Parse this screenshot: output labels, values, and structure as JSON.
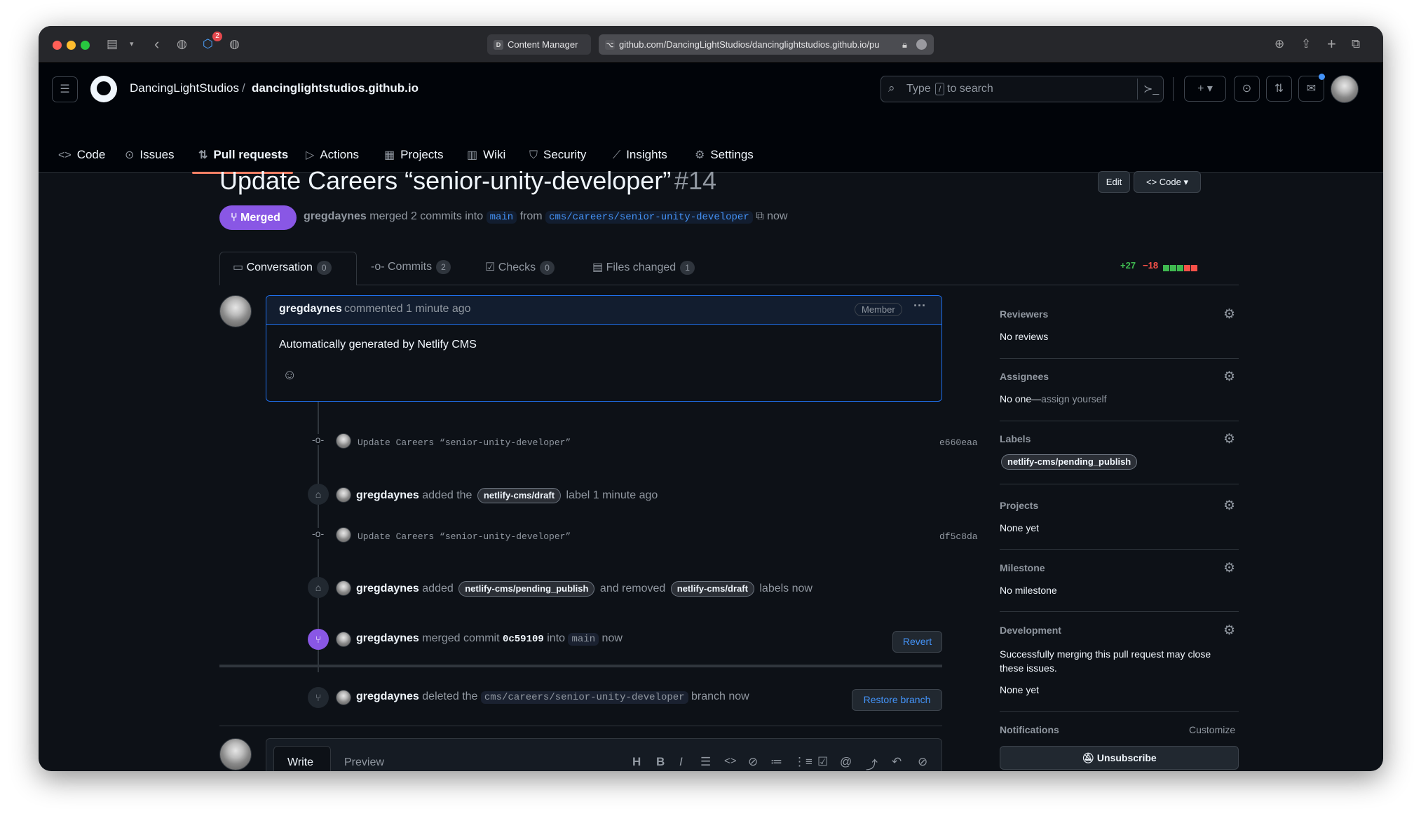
{
  "browser": {
    "tabs": [
      {
        "favicon": "D",
        "title": "Content Manager"
      },
      {
        "favicon": "⌥",
        "title": "github.com/DancingLightStudios/dancinglightstudios.github.io/pu"
      }
    ],
    "extension_badge": "2"
  },
  "header": {
    "owner": "DancingLightStudios",
    "separator": "/",
    "repo": "dancinglightstudios.github.io",
    "search_placeholder_pre": "Type",
    "search_key": "/",
    "search_placeholder_post": "to search",
    "nav": [
      {
        "label": "Code",
        "icon": "code-icon"
      },
      {
        "label": "Issues",
        "icon": "issue-icon"
      },
      {
        "label": "Pull requests",
        "icon": "pull-request-icon"
      },
      {
        "label": "Actions",
        "icon": "play-icon"
      },
      {
        "label": "Projects",
        "icon": "table-icon"
      },
      {
        "label": "Wiki",
        "icon": "book-icon"
      },
      {
        "label": "Security",
        "icon": "shield-icon"
      },
      {
        "label": "Insights",
        "icon": "graph-icon"
      },
      {
        "label": "Settings",
        "icon": "gear-icon"
      }
    ],
    "selected_nav": "Pull requests"
  },
  "pr": {
    "title": "Update Careers “senior-unity-developer”",
    "number": "#14",
    "edit_label": "Edit",
    "code_label": "Code",
    "state": "Merged",
    "author": "gregdaynes",
    "merge_text": "merged 2 commits into",
    "base": "main",
    "from_text": "from",
    "head": "cms/careers/senior-unity-developer",
    "time": "now",
    "tabs": [
      {
        "label": "Conversation",
        "count": "0"
      },
      {
        "label": "Commits",
        "count": "2"
      },
      {
        "label": "Checks",
        "count": "0"
      },
      {
        "label": "Files changed",
        "count": "1"
      }
    ],
    "additions": "+27",
    "deletions": "−18",
    "diffstat_colors": [
      "#3fb950",
      "#3fb950",
      "#3fb950",
      "#f85149",
      "#f85149"
    ]
  },
  "comment": {
    "author": "gregdaynes",
    "meta": "commented 1 minute ago",
    "badge": "Member",
    "body": "Automatically generated by Netlify CMS"
  },
  "timeline": {
    "commit1": {
      "message": "Update Careers “senior-unity-developer”",
      "sha": "e660eaa"
    },
    "label1": {
      "actor": "gregdaynes",
      "pre": "added the",
      "label": "netlify-cms/draft",
      "post": "label 1 minute ago"
    },
    "commit2": {
      "message": "Update Careers “senior-unity-developer”",
      "sha": "df5c8da"
    },
    "label2": {
      "actor": "gregdaynes",
      "pre": "added",
      "added_label": "netlify-cms/pending_publish",
      "mid": "and removed",
      "removed_label": "netlify-cms/draft",
      "post": "labels now"
    },
    "merged": {
      "actor": "gregdaynes",
      "pre": "merged commit",
      "sha": "0c59109",
      "mid": "into",
      "base": "main",
      "post": "now",
      "button": "Revert"
    },
    "deleted": {
      "actor": "gregdaynes",
      "pre": "deleted the",
      "branch": "cms/careers/senior-unity-developer",
      "post": "branch now",
      "button": "Restore branch"
    }
  },
  "editor": {
    "write_tab": "Write",
    "preview_tab": "Preview",
    "toolbar_icons": [
      "heading-icon",
      "bold-icon",
      "italic-icon",
      "quote-icon",
      "code-icon",
      "link-icon",
      "unordered-list-icon",
      "ordered-list-icon",
      "task-list-icon",
      "mention-icon",
      "reference-icon",
      "reply-icon",
      "slash-icon"
    ]
  },
  "sidebar": {
    "reviewers": {
      "title": "Reviewers",
      "value": "No reviews"
    },
    "assignees": {
      "title": "Assignees",
      "value": "No one—",
      "link": "assign yourself"
    },
    "labels": {
      "title": "Labels",
      "value": "netlify-cms/pending_publish"
    },
    "projects": {
      "title": "Projects",
      "value": "None yet"
    },
    "milestone": {
      "title": "Milestone",
      "value": "No milestone"
    },
    "development": {
      "title": "Development",
      "text": "Successfully merging this pull request may close these issues.",
      "value": "None yet"
    },
    "notifications": {
      "title": "Notifications",
      "customize": "Customize",
      "button": "Unsubscribe"
    }
  },
  "colors": {
    "merged": "#8957e5",
    "accent": "#4493f8",
    "underline": "#f78166"
  }
}
